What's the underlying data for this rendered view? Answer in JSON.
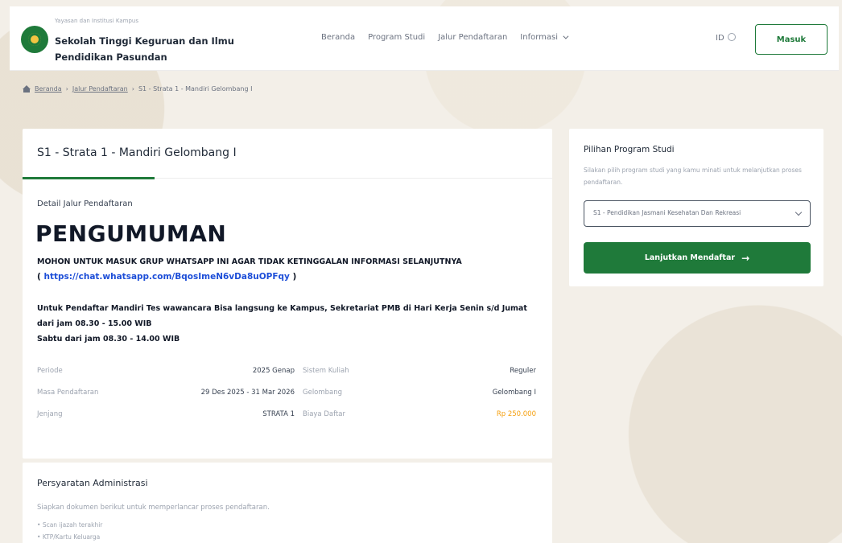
{
  "header": {
    "brand_super": "Yayasan dan Institusi Kampus",
    "brand_name": "Sekolah Tinggi Keguruan dan Ilmu Pendidikan Pasundan",
    "nav": [
      "Beranda",
      "Program Studi",
      "Jalur Pendaftaran",
      "Informasi"
    ],
    "lang": "ID",
    "login_label": "Masuk"
  },
  "breadcrumb": {
    "home": "Beranda",
    "jalur": "Jalur Pendaftaran",
    "current": "S1 - Strata 1 - Mandiri Gelombang I"
  },
  "main": {
    "title": "S1 - Strata 1 - Mandiri Gelombang I",
    "detail_label": "Detail Jalur Pendaftaran",
    "announcement_title": "PENGUMUMAN",
    "announcement_line1": "MOHON UNTUK MASUK GRUP WHATSAPP INI AGAR TIDAK KETINGGALAN INFORMASI SELANJUTNYA",
    "announcement_link": "https://chat.whatsapp.com/BqosImeN6vDa8uOPFqy",
    "announcement_p2": "Untuk Pendaftar Mandiri Tes wawancara Bisa langsung ke Kampus, Sekretariat PMB di Hari Kerja Senin s/d Jumat dari jam 08.30 - 15.00 WIB",
    "announcement_p3": "Sabtu dari jam 08.30 - 14.00 WIB",
    "info": [
      {
        "label": "Periode",
        "value": "2025 Genap",
        "label2": "Sistem Kuliah",
        "value2": "Reguler"
      },
      {
        "label": "Masa Pendaftaran",
        "value": "29 Des 2025 - 31 Mar 2026",
        "label2": "Gelombang",
        "value2": "Gelombang I"
      },
      {
        "label": "Jenjang",
        "value": "STRATA 1",
        "label2": "Biaya Daftar",
        "value2": "Rp 250.000"
      }
    ]
  },
  "requirements": {
    "title": "Persyaratan Administrasi",
    "desc": "Siapkan dokumen berikut untuk memperlancar proses pendaftaran.",
    "items": [
      "Scan ijazah terakhir",
      "KTP/Kartu Keluarga"
    ]
  },
  "sidebar": {
    "title": "Pilihan Program Studi",
    "desc": "Silakan pilih program studi yang kamu minati untuk melanjutkan proses pendaftaran.",
    "select_value": "S1 - Pendidikan Jasmani Kesehatan Dan Rekreasi",
    "continue_label": "Lanjutkan Mendaftar"
  },
  "colors": {
    "accent": "#1f7a3a",
    "fee": "#f59e0b",
    "link": "#1d4ed8"
  }
}
